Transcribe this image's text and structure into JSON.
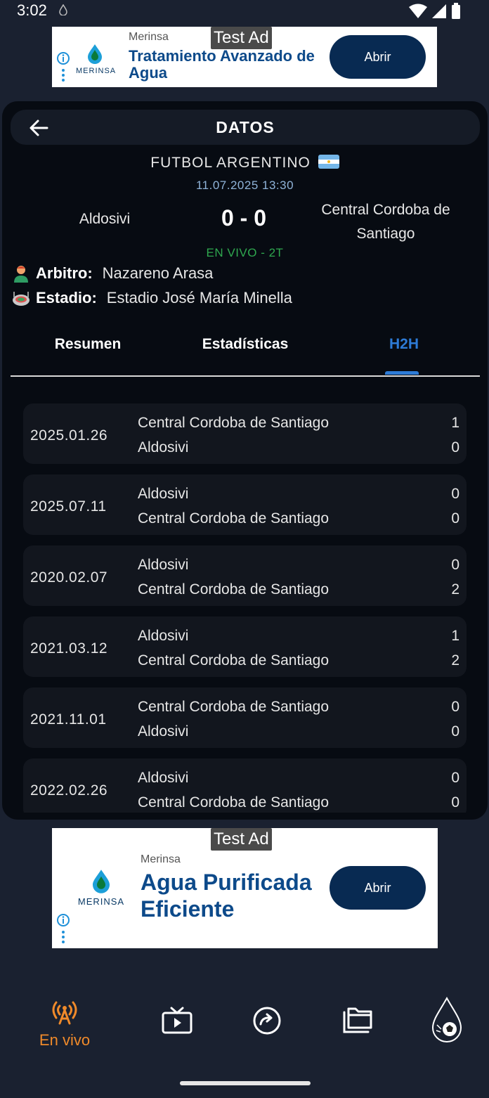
{
  "status_bar": {
    "time": "3:02"
  },
  "ad_top": {
    "tag": "Test Ad",
    "brand": "Merinsa",
    "logo_text": "MERINSA",
    "headline": "Tratamiento Avanzado de Agua",
    "button": "Abrir"
  },
  "header": {
    "title": "DATOS"
  },
  "match": {
    "league": "FUTBOL ARGENTINO",
    "datetime": "11.07.2025 13:30",
    "home_team": "Aldosivi",
    "away_team": "Central Cordoba de Santiago",
    "score": "0 - 0",
    "status": "EN VIVO - 2T",
    "referee_label": "Arbitro:",
    "referee": "Nazareno Arasa",
    "stadium_label": "Estadio:",
    "stadium": "Estadio José María Minella"
  },
  "tabs": [
    {
      "label": "Resumen"
    },
    {
      "label": "Estadísticas"
    },
    {
      "label": "H2H"
    }
  ],
  "active_tab": "H2H",
  "h2h": [
    {
      "date": "2025.01.26",
      "team1": "Central Cordoba de Santiago",
      "score1": "1",
      "team2": "Aldosivi",
      "score2": "0"
    },
    {
      "date": "2025.07.11",
      "team1": "Aldosivi",
      "score1": "0",
      "team2": "Central Cordoba de Santiago",
      "score2": "0"
    },
    {
      "date": "2020.02.07",
      "team1": "Aldosivi",
      "score1": "0",
      "team2": "Central Cordoba de Santiago",
      "score2": "2"
    },
    {
      "date": "2021.03.12",
      "team1": "Aldosivi",
      "score1": "1",
      "team2": "Central Cordoba de Santiago",
      "score2": "2"
    },
    {
      "date": "2021.11.01",
      "team1": "Central Cordoba de Santiago",
      "score1": "0",
      "team2": "Aldosivi",
      "score2": "0"
    },
    {
      "date": "2022.02.26",
      "team1": "Aldosivi",
      "score1": "0",
      "team2": "Central Cordoba de Santiago",
      "score2": "0"
    }
  ],
  "ad_bottom": {
    "tag": "Test Ad",
    "brand": "Merinsa",
    "logo_text": "MERINSA",
    "headline": "Agua Purificada Eficiente",
    "button": "Abrir"
  },
  "bottom_nav": {
    "live_label": "En vivo",
    "icons": [
      "live-broadcast-icon",
      "tv-icon",
      "refresh-icon",
      "folder-icon",
      "app-logo-icon"
    ]
  },
  "colors": {
    "background": "#1a2130",
    "card": "#070b12",
    "accent_blue": "#2d7bd6",
    "live_green": "#2fa84f",
    "nav_active": "#f08a2a",
    "ad_button": "#082a52"
  }
}
